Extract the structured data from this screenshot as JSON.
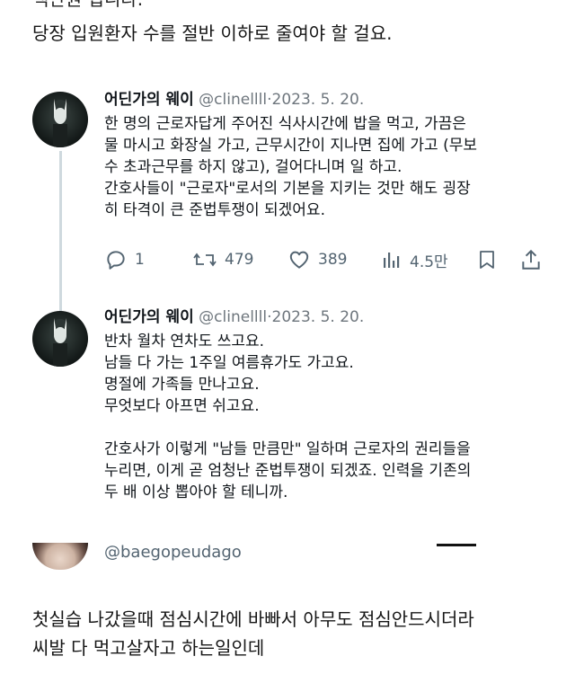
{
  "header": {
    "partial_line": "백만원 입니다.",
    "line2": "당장 입원환자 수를 절반 이하로 줄여야 할 걸요."
  },
  "tweets": [
    {
      "display_name": "어딘가의 웨이",
      "handle": "@clinellll",
      "date": "2023. 5. 20.",
      "lines": [
        "한 명의 근로자답게 주어진 식사시간에 밥을 먹고, 가끔은",
        "물 마시고 화장실 가고, 근무시간이 지나면 집에 가고 (무보",
        "수 초과근무를 하지 않고), 걸어다니며 일 하고.",
        "간호사들이 \"근로자\"로서의 기본을 지키는 것만 해도 굉장",
        "히 타격이 큰 준법투쟁이 되겠어요."
      ],
      "actions": {
        "replies": "1",
        "retweets": "479",
        "likes": "389",
        "views": "4.5만"
      }
    },
    {
      "display_name": "어딘가의 웨이",
      "handle": "@clinellll",
      "date": "2023. 5. 20.",
      "lines": [
        "반차 월차 연차도 쓰고요.",
        "남들 다 가는 1주일 여름휴가도 가고요.",
        "명절에 가족들 만나고요.",
        "무엇보다 아프면 쉬고요.",
        "",
        "간호사가 이렇게 \"남들 만큼만\" 일하며 근로자의 권리들을",
        "누리면, 이게 곧 엄청난 준법투쟁이 되겠죠. 인력을 기존의",
        "두 배 이상 뽑아야 할 테니까."
      ]
    }
  ],
  "reply": {
    "handle": "@baegopeudago"
  },
  "footer": {
    "line1": "첫실습 나갔을때 점심시간에 바빠서 아무도 점심안드시더라",
    "line2": "씨발 다 먹고살자고 하는일인데"
  },
  "colors": {
    "text": "#0f1419",
    "muted": "#536471",
    "thread_line": "#cfd9de"
  }
}
